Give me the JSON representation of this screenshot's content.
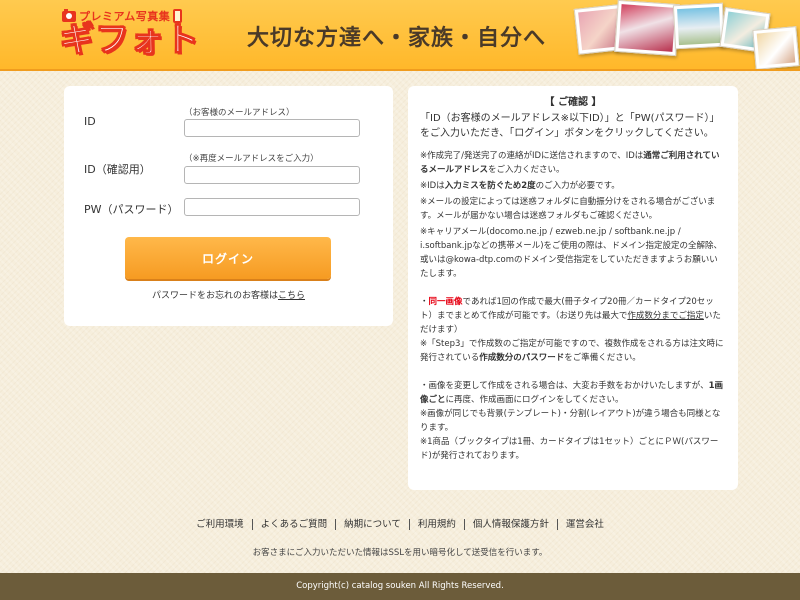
{
  "header": {
    "logo_subtitle": "プレミアム写真集",
    "logo_title": "ギフォト",
    "tagline": "大切な方達へ・家族・自分へ"
  },
  "login": {
    "id_label": "ID",
    "id_hint": "（お客様のメールアドレス）",
    "id_value": "",
    "id_confirm_label": "ID（確認用）",
    "id_confirm_hint": "（※再度メールアドレスをご入力）",
    "id_confirm_value": "",
    "pw_label": "PW（パスワード）",
    "pw_value": "",
    "login_button": "ログイン",
    "forgot_prefix": "パスワードをお忘れのお客様は",
    "forgot_link": "こちら"
  },
  "info": {
    "title": "【 ご確認 】",
    "intro": "「ID（お客様のメールアドレス※以下ID）」と「PW(パスワード）」をご入力いただき、「ログイン」ボタンをクリックしてください。",
    "note1_a": "※作成完了/発送完了の連絡がIDに送信されますので、IDは",
    "note1_b": "通常ご利用されているメールアドレス",
    "note1_c": "をご入力ください。",
    "note2_a": "※IDは",
    "note2_b": "入力ミスを防ぐため2度",
    "note2_c": "のご入力が必要です。",
    "note3": "※メールの設定によっては迷惑フォルダに自動振分けをされる場合がございます。メールが届かない場合は迷惑フォルダもご確認ください。",
    "note4": "※キャリアメール(docomo.ne.jp / ezweb.ne.jp / softbank.ne.jp / i.softbank.jpなどの携帯メール)をご使用の際は、ドメイン指定設定の全解除、或いは@kowa-dtp.comのドメイン受信指定をしていただきますようお願いいたします。",
    "note5_prefix": "・",
    "note5_red": "同一画像",
    "note5_a": "であれば1回の作成で最大(冊子タイプ20冊／カードタイプ20セット）までまとめて作成が可能です。（お送り先は最大で",
    "note5_ul": "作成数分までご指定",
    "note5_b": "いただけます）",
    "note6_a": "※「Step3」で作成数のご指定が可能ですので、複数作成をされる方は注文時に発行されている",
    "note6_b": "作成数分のパスワード",
    "note6_c": "をご準備ください。",
    "note7_a": "・画像を変更して作成をされる場合は、大変お手数をおかけいたしますが、",
    "note7_b": "1画像ごと",
    "note7_c": "に再度、作成画面にログインをしてください。",
    "note8": "※画像が同じでも背景(テンプレート)・分割(レイアウト)が違う場合も同様となります。",
    "note9": "※1商品（ブックタイプは1冊、カードタイプは1セット）ごとにＰＷ(パスワード)が発行されております。"
  },
  "footer": {
    "links": [
      "ご利用環境",
      "よくあるご質問",
      "納期について",
      "利用規約",
      "個人情報保護方針",
      "運営会社"
    ],
    "ssl_note": "お客さまにご入力いただいた情報はSSLを用い暗号化して送受信を行います。",
    "copyright": "Copyright(c) catalog souken All Rights Reserved."
  },
  "colors": {
    "header_bg": "#ffb82a",
    "accent_orange": "#f69b22",
    "logo_red": "#e8341d",
    "footer_bar": "#6c5c3a",
    "warning_red": "#e60012"
  }
}
